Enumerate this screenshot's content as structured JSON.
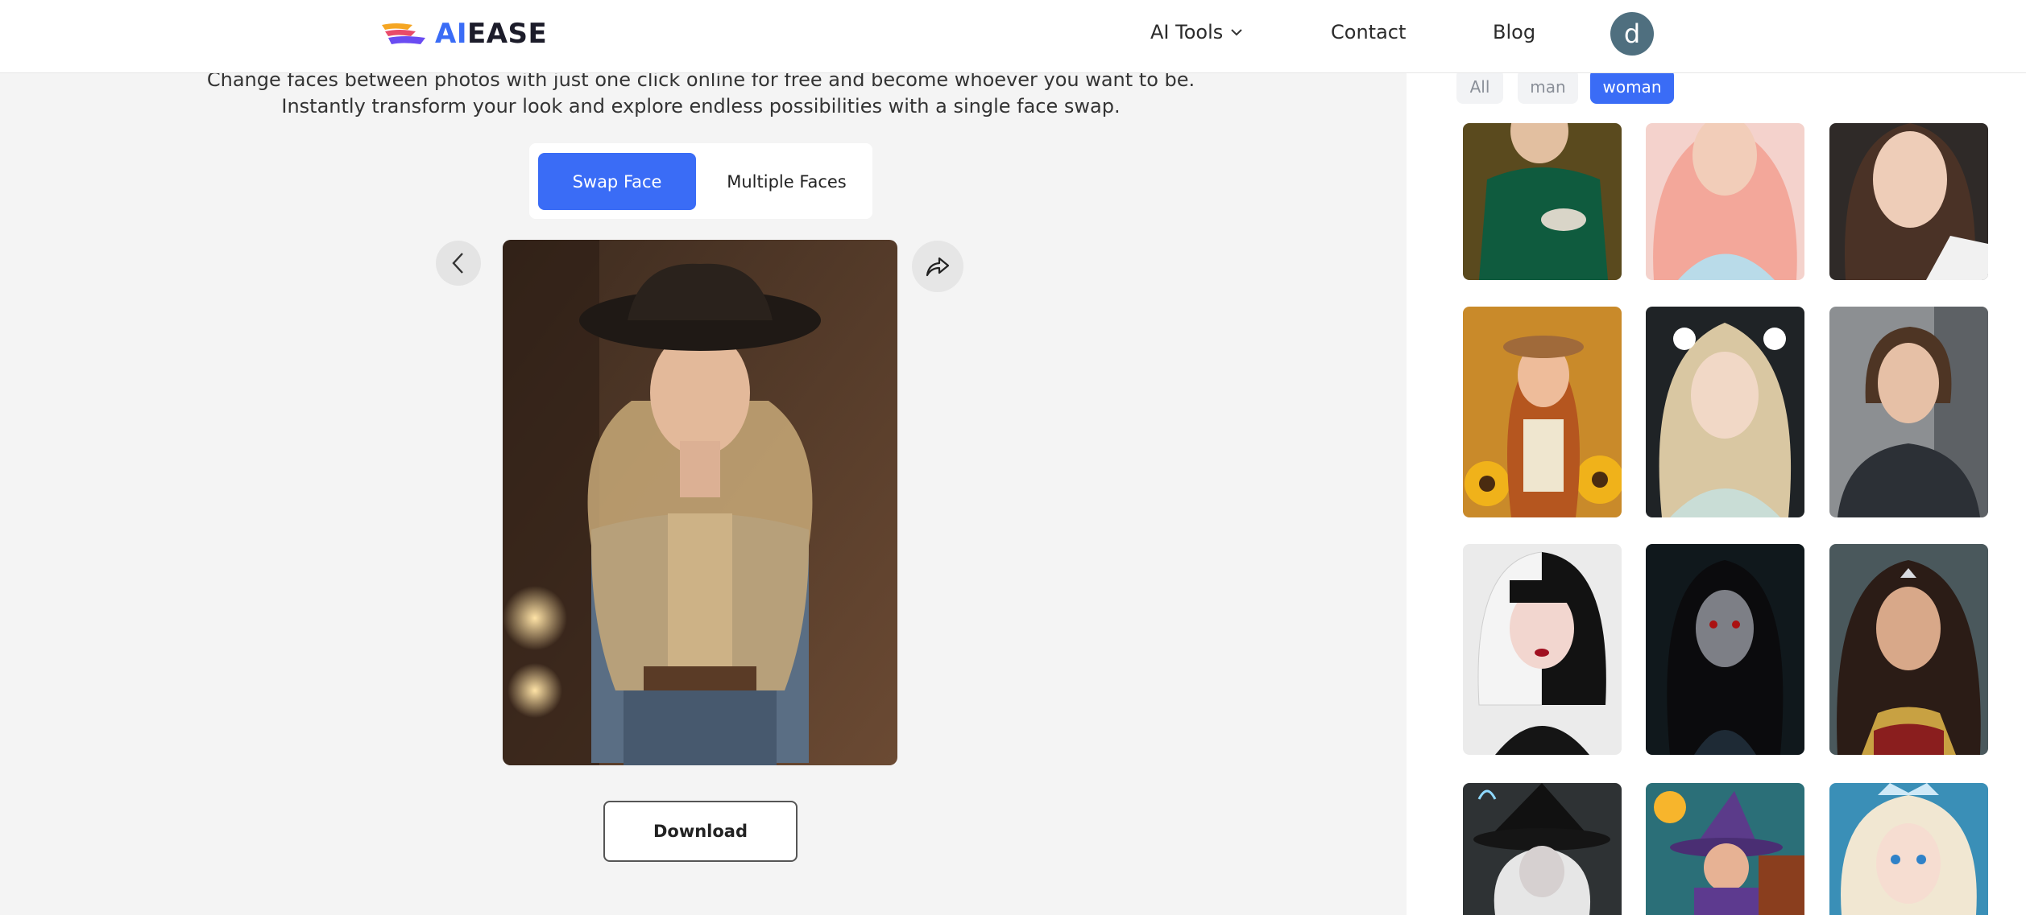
{
  "header": {
    "logo_ai": "AI",
    "logo_ease": "EASE",
    "nav": {
      "ai_tools": "AI Tools",
      "contact": "Contact",
      "blog": "Blog"
    },
    "avatar_initial": "d"
  },
  "main": {
    "subtitle": "Change faces between photos with just one click online for free and become whoever you want to be. Instantly transform your look and explore endless possibilities with a single face swap.",
    "tabs": [
      {
        "label": "Swap Face",
        "active": true
      },
      {
        "label": "Multiple Faces",
        "active": false
      }
    ],
    "download_label": "Download"
  },
  "templates": {
    "filters": [
      {
        "label": "All",
        "active": false
      },
      {
        "label": "man",
        "active": false
      },
      {
        "label": "woman",
        "active": true
      }
    ]
  },
  "colors": {
    "accent": "#3a6cf6",
    "background": "#f4f4f4",
    "panel": "#ffffff"
  }
}
